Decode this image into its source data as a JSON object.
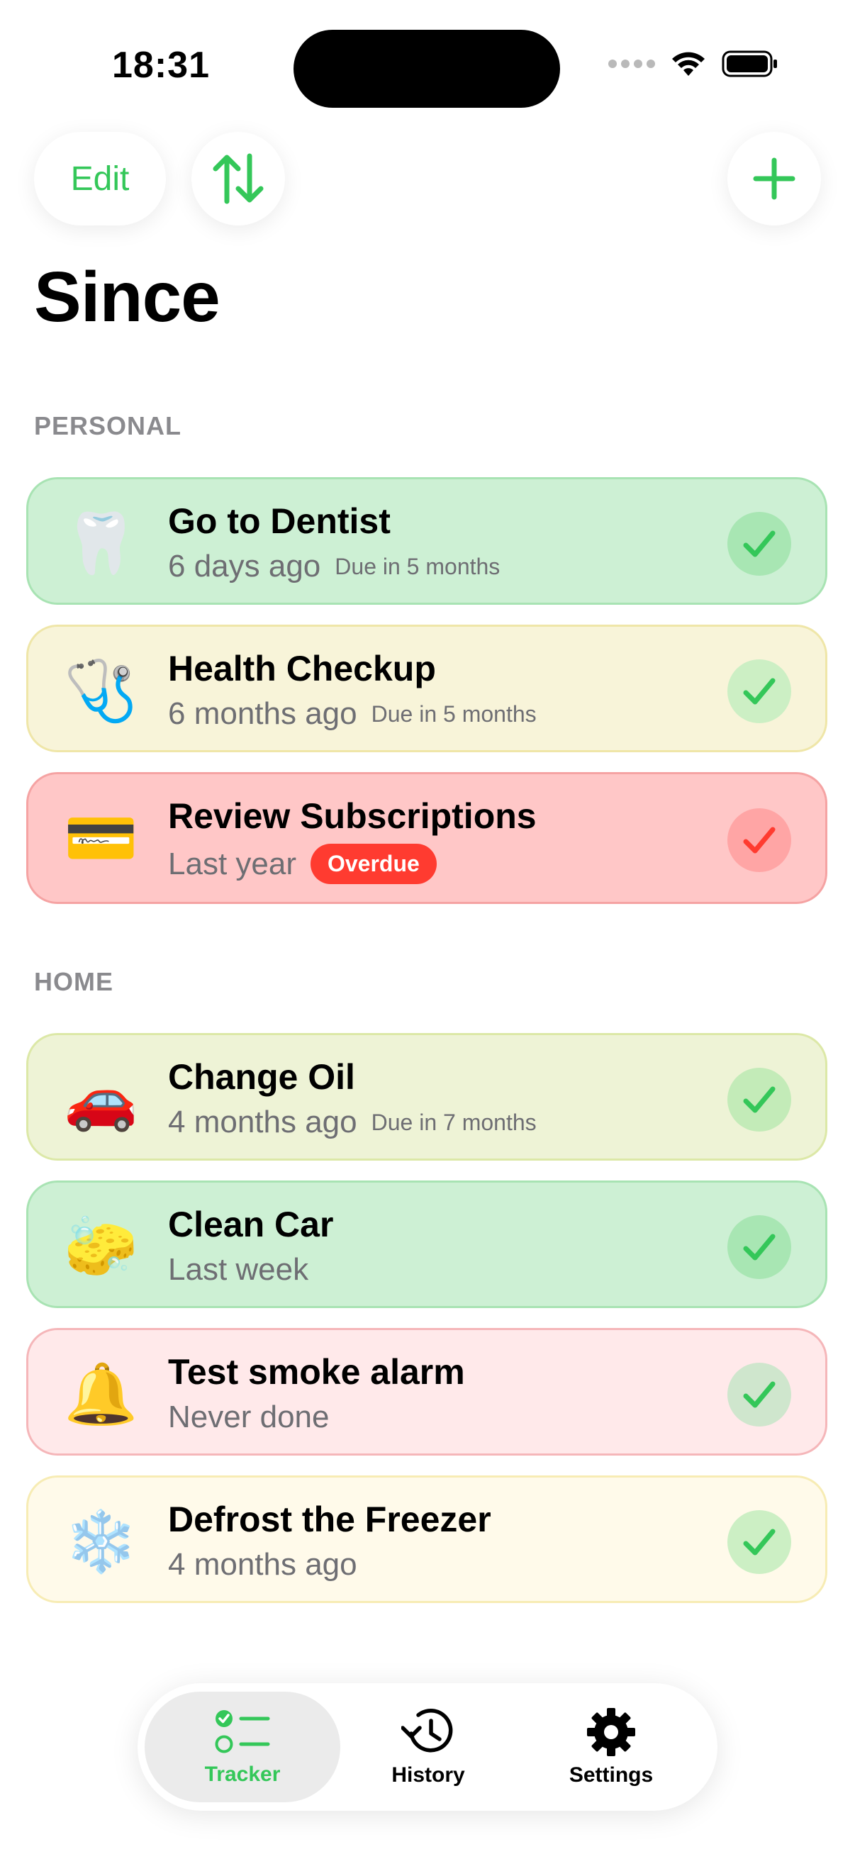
{
  "status_bar": {
    "time": "18:31"
  },
  "toolbar": {
    "edit_label": "Edit",
    "sort_icon": "arrow-up-down-icon",
    "add_icon": "plus-icon"
  },
  "page": {
    "title": "Since"
  },
  "sections": [
    {
      "header": "PERSONAL",
      "items": [
        {
          "emoji": "🦷",
          "title": "Go to Dentist",
          "since": "6 days ago",
          "due": "Due in 5 months",
          "status": "green"
        },
        {
          "emoji": "🩺",
          "title": "Health Checkup",
          "since": "6 months ago",
          "due": "Due in 5 months",
          "status": "yellow"
        },
        {
          "emoji": "💳",
          "title": "Review Subscriptions",
          "since": "Last year",
          "badge": "Overdue",
          "status": "red"
        }
      ]
    },
    {
      "header": "HOME",
      "items": [
        {
          "emoji": "🚗",
          "title": "Change Oil",
          "since": "4 months ago",
          "due": "Due in 7 months",
          "status": "lime"
        },
        {
          "emoji": "🧽",
          "title": "Clean Car",
          "since": "Last week",
          "status": "green"
        },
        {
          "emoji": "🔔",
          "title": "Test smoke alarm",
          "since": "Never done",
          "status": "pink"
        },
        {
          "emoji": "❄️",
          "title": "Defrost the Freezer",
          "since": "4 months ago",
          "status": "cream"
        }
      ]
    }
  ],
  "tabbar": {
    "tabs": [
      {
        "label": "Tracker",
        "icon": "checklist-icon",
        "active": true
      },
      {
        "label": "History",
        "icon": "clock-history-icon",
        "active": false
      },
      {
        "label": "Settings",
        "icon": "gear-icon",
        "active": false
      }
    ]
  },
  "colors": {
    "accent": "#34c759",
    "overdue": "#ff3b30",
    "check_green": "#34c759",
    "check_red": "#ff3b30"
  }
}
